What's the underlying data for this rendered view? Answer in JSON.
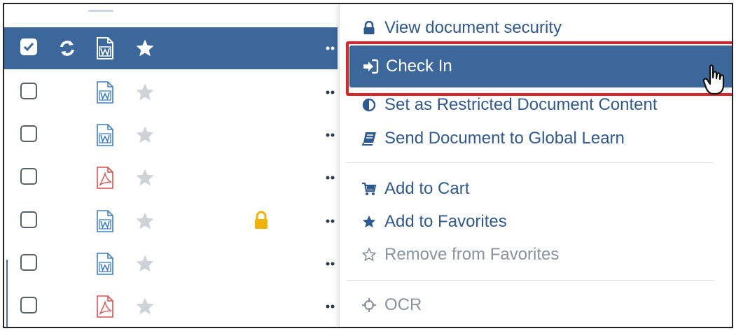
{
  "menu": {
    "items": [
      {
        "label": "View document security",
        "icon": "lock-icon"
      },
      {
        "label": "Check In",
        "icon": "sign-in-icon"
      },
      {
        "label": "Set as Restricted Document Content",
        "icon": "half-circle-shield-icon"
      },
      {
        "label": "Send Document to Global Learn",
        "icon": "book-icon"
      },
      {
        "label": "Add to Cart",
        "icon": "cart-icon"
      },
      {
        "label": "Add to Favorites",
        "icon": "star-filled-icon"
      },
      {
        "label": "Remove from Favorites",
        "icon": "star-outline-icon"
      },
      {
        "label": "OCR",
        "icon": "crosshair-icon"
      }
    ]
  },
  "documents": [
    {
      "selected": true,
      "type": "word",
      "favorite": true,
      "locked": false
    },
    {
      "selected": false,
      "type": "word",
      "favorite": false,
      "locked": false
    },
    {
      "selected": false,
      "type": "word",
      "favorite": false,
      "locked": false
    },
    {
      "selected": false,
      "type": "pdf",
      "favorite": false,
      "locked": false
    },
    {
      "selected": false,
      "type": "word",
      "favorite": false,
      "locked": true
    },
    {
      "selected": false,
      "type": "word",
      "favorite": false,
      "locked": false
    },
    {
      "selected": false,
      "type": "pdf",
      "favorite": false,
      "locked": false
    }
  ],
  "colors": {
    "accent": "#3b679b",
    "highlight_border": "#d9262c",
    "menu_text": "#2f5a8f",
    "pdf_icon": "#d9534f",
    "word_icon": "#3e7fc1",
    "lock": "#f0b400",
    "star_muted": "#cfd3d8"
  }
}
